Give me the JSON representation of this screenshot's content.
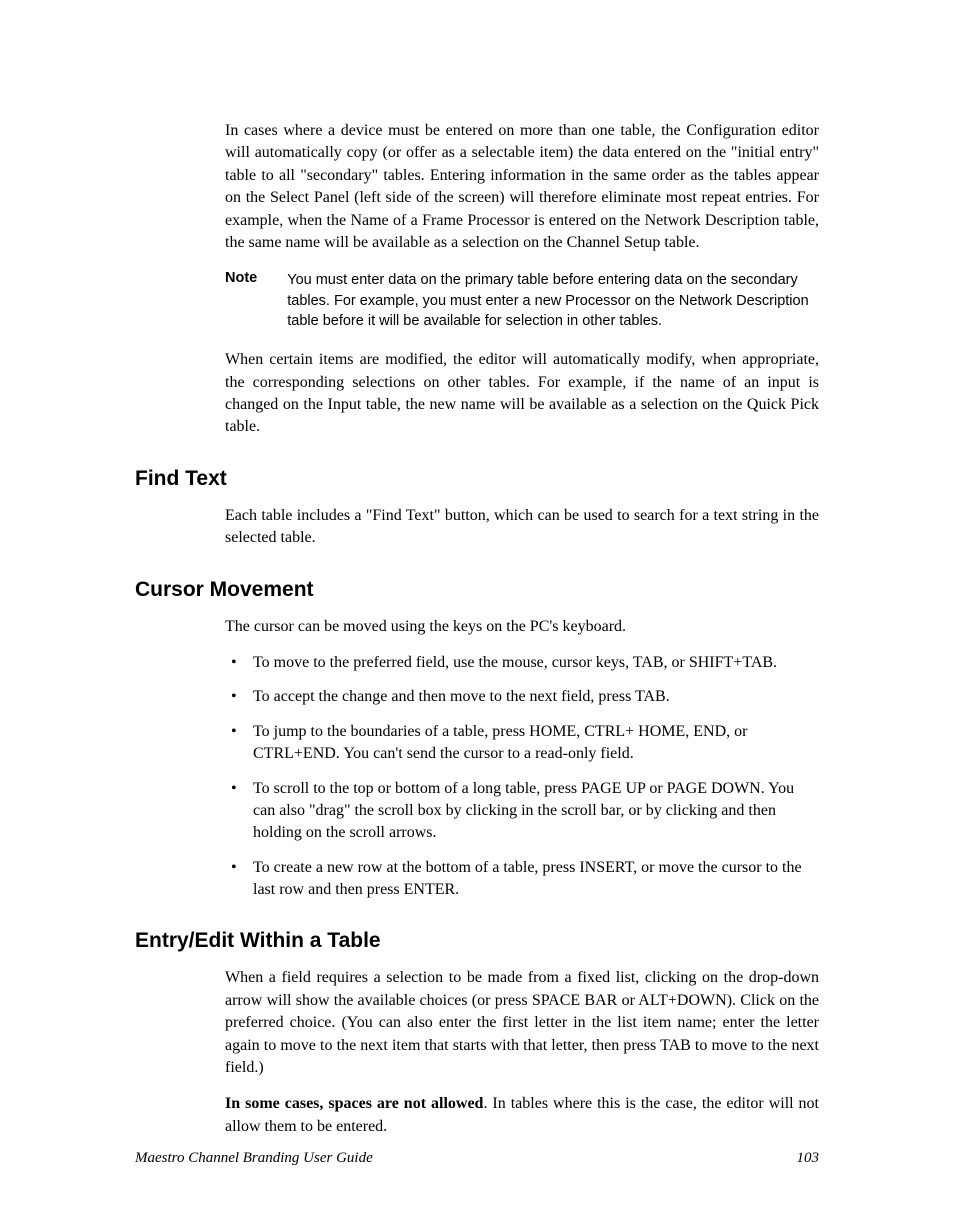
{
  "paragraphs": {
    "intro": "In cases where a device must be entered on more than one table, the Configuration editor will automatically copy (or offer as a selectable item) the data entered on the \"initial entry\" table to all \"secondary\" tables. Entering information in the same order as the tables appear on the Select Panel (left side of the screen) will therefore eliminate most repeat entries. For example, when the Name of a Frame Processor is entered on the Network Description table, the same name will be available as a selection on the Channel Setup table.",
    "note_label": "Note",
    "note_text": "You must enter data on the primary table before entering data on the secondary tables. For example, you must enter a new Processor on the Network Description table before it will be available for selection in other tables.",
    "modified": "When certain items are modified, the editor will automatically modify, when appropriate, the corresponding selections on other tables. For example, if the name of an input is changed on the Input table, the new name will be available as a selection on the Quick Pick table."
  },
  "sections": {
    "find_text": {
      "heading": "Find Text",
      "body": "Each table includes a \"Find Text\" button, which can be used to search for a text string in the selected table."
    },
    "cursor_movement": {
      "heading": "Cursor Movement",
      "intro": "The cursor can be moved using the keys on the PC's keyboard.",
      "bullets": [
        "To move to the preferred field, use the mouse, cursor keys, TAB, or SHIFT+TAB.",
        "To accept the change and then move to the next field, press TAB.",
        "To jump to the boundaries of a table, press HOME, CTRL+ HOME, END, or CTRL+END. You can't send the cursor to a read-only field.",
        "To scroll to the top or bottom of a long table, press PAGE UP or PAGE DOWN. You can also \"drag\" the scroll box by clicking in the scroll bar, or by clicking and then holding on the scroll arrows.",
        "To create a new row at the bottom of a table, press INSERT, or move the cursor to the last row and then press ENTER."
      ]
    },
    "entry_edit": {
      "heading": "Entry/Edit Within a Table",
      "body1": "When a field requires a selection to be made from a fixed list, clicking on the drop-down arrow will show the available choices (or press SPACE BAR or ALT+DOWN). Click on the preferred choice. (You can also enter the first letter in the list item name; enter the letter again to move to the next item that starts with that letter, then press TAB to move to the next field.)",
      "body2_bold": "In some cases, spaces are not allowed",
      "body2_rest": ". In tables where this is the case, the editor will not allow them to be entered."
    }
  },
  "footer": {
    "title": "Maestro Channel Branding User Guide",
    "page": "103"
  }
}
